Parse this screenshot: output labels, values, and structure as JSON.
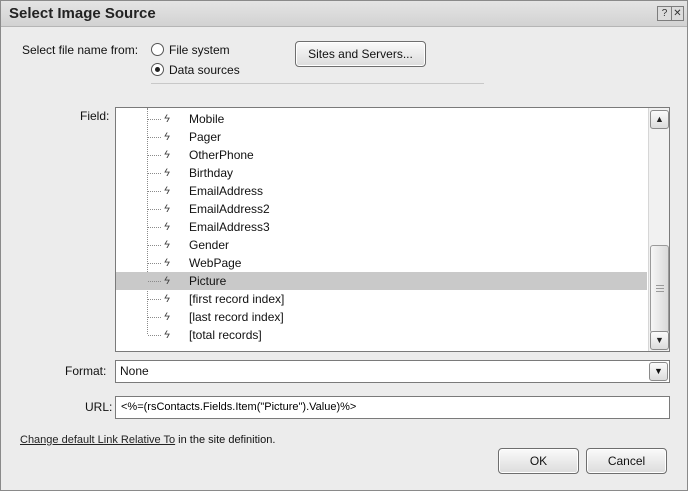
{
  "window": {
    "title": "Select Image Source",
    "help_glyph": "?",
    "close_glyph": "✕"
  },
  "source": {
    "label": "Select file name from:",
    "options": [
      "File system",
      "Data sources"
    ],
    "selected": "Data sources",
    "sites_button": "Sites and Servers..."
  },
  "field": {
    "label": "Field:",
    "items": [
      "Mobile",
      "Pager",
      "OtherPhone",
      "Birthday",
      "EmailAddress",
      "EmailAddress2",
      "EmailAddress3",
      "Gender",
      "WebPage",
      "Picture",
      "[first record index]",
      "[last record index]",
      "[total records]"
    ],
    "selected": "Picture",
    "field_icon": "lightning-bolt-icon"
  },
  "format": {
    "label": "Format:",
    "value": "None"
  },
  "url": {
    "label": "URL:",
    "value": "<%=(rsContacts.Fields.Item(\"Picture\").Value)%>"
  },
  "footer": {
    "link_text": "Change default Link Relative To",
    "suffix": " in the site definition."
  },
  "buttons": {
    "ok": "OK",
    "cancel": "Cancel"
  }
}
